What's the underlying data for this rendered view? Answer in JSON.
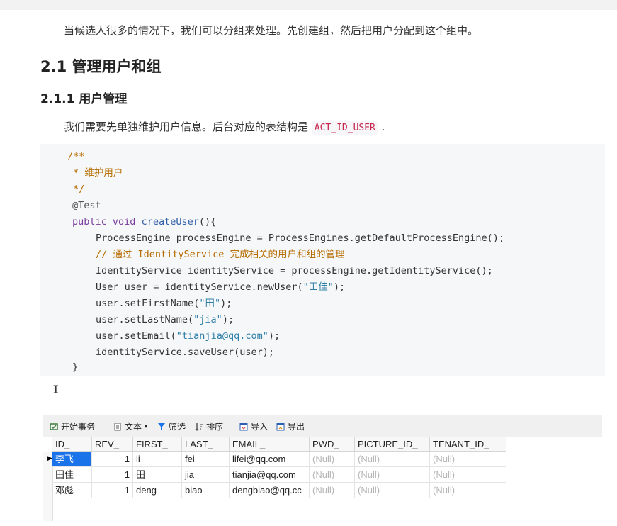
{
  "doc": {
    "para1": "当候选人很多的情况下，我们可以分组来处理。先创建组，然后把用户分配到这个组中。",
    "heading_21": "2.1 管理用户和组",
    "heading_211": "2.1.1 用户管理",
    "para2_prefix": "我们需要先单独维护用户信息。后台对应的表结构是 ",
    "para2_code": "ACT_ID_USER",
    "para2_suffix": " ."
  },
  "code": {
    "l1": "/**",
    "l2": " * 维护用户",
    "l3": " */",
    "l4": "@Test",
    "l5_kw1": "public",
    "l5_kw2": "void",
    "l5_fn": "createUser",
    "l5_rest": "(){",
    "l6": "ProcessEngine processEngine = ProcessEngines.getDefaultProcessEngine();",
    "l7": "// 通过 IdentityService 完成相关的用户和组的管理",
    "l8": "IdentityService identityService = processEngine.getIdentityService();",
    "l9_a": "User user = identityService.newUser(",
    "l9_s": "\"田佳\"",
    "l9_b": ");",
    "l10_a": "user.setFirstName(",
    "l10_s": "\"田\"",
    "l10_b": ");",
    "l11_a": "user.setLastName(",
    "l11_s": "\"jia\"",
    "l11_b": ");",
    "l12_a": "user.setEmail(",
    "l12_s": "\"tianjia@qq.com\"",
    "l12_b": ");",
    "l13": "identityService.saveUser(user);",
    "l14": "}"
  },
  "toolbar": {
    "begin": "开始事务",
    "text": "文本",
    "filter": "筛选",
    "sort": "排序",
    "import": "导入",
    "export": "导出"
  },
  "table": {
    "columns": [
      "ID_",
      "REV_",
      "FIRST_",
      "LAST_",
      "EMAIL_",
      "PWD_",
      "PICTURE_ID_",
      "TENANT_ID_"
    ],
    "rows": [
      [
        "李飞",
        "1",
        "li",
        "fei",
        "lifei@qq.com",
        "(Null)",
        "(Null)",
        "(Null)"
      ],
      [
        "田佳",
        "1",
        "田",
        "jia",
        "tianjia@qq.com",
        "(Null)",
        "(Null)",
        "(Null)"
      ],
      [
        "邓彪",
        "1",
        "deng",
        "biao",
        "dengbiao@qq.cc",
        "(Null)",
        "(Null)",
        "(Null)"
      ]
    ]
  },
  "colors": {
    "accent": "#1a73e8",
    "code_comment": "#b66c00",
    "keyword": "#7a3e9d",
    "inline_code": "#c7254e"
  }
}
